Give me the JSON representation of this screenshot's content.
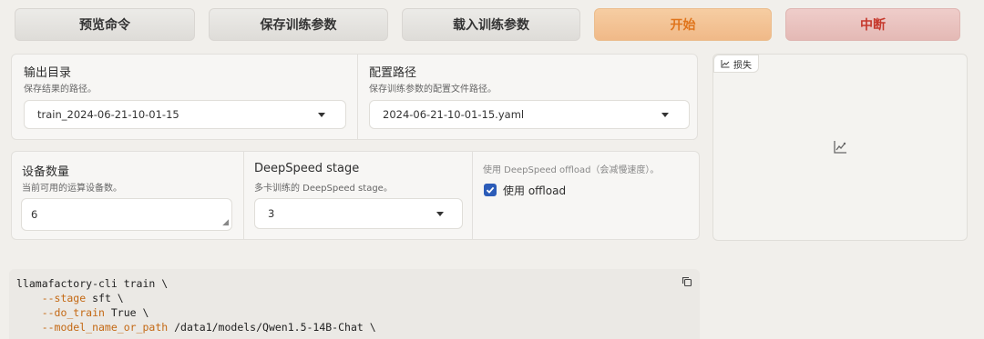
{
  "actions": {
    "preview": "预览命令",
    "save": "保存训练参数",
    "load": "载入训练参数",
    "start": "开始",
    "abort": "中断"
  },
  "output_dir": {
    "label": "输出目录",
    "info": "保存结果的路径。",
    "value": "train_2024-06-21-10-01-15"
  },
  "config_path": {
    "label": "配置路径",
    "info": "保存训练参数的配置文件路径。",
    "value": "2024-06-21-10-01-15.yaml"
  },
  "device_count": {
    "label": "设备数量",
    "info": "当前可用的运算设备数。",
    "value": "6"
  },
  "ds_stage": {
    "label": "DeepSpeed stage",
    "info": "多卡训练的 DeepSpeed stage。",
    "value": "3"
  },
  "ds_offload": {
    "info": "使用 DeepSpeed offload（会减慢速度）。",
    "label": "使用 offload",
    "checked": true
  },
  "loss_chart": {
    "tab_label": "损失"
  },
  "command": {
    "lines": [
      {
        "flag": "",
        "text": "llamafactory-cli train \\"
      },
      {
        "flag": "    --stage",
        "text": " sft \\"
      },
      {
        "flag": "    --do_train",
        "text": " True \\"
      },
      {
        "flag": "    --model_name_or_path",
        "text": " /data1/models/Qwen1.5-14B-Chat \\"
      }
    ]
  },
  "colors": {
    "accent_orange": "#e0751c",
    "stop_red": "#c6392d",
    "checkbox_blue": "#2c5cb8"
  }
}
